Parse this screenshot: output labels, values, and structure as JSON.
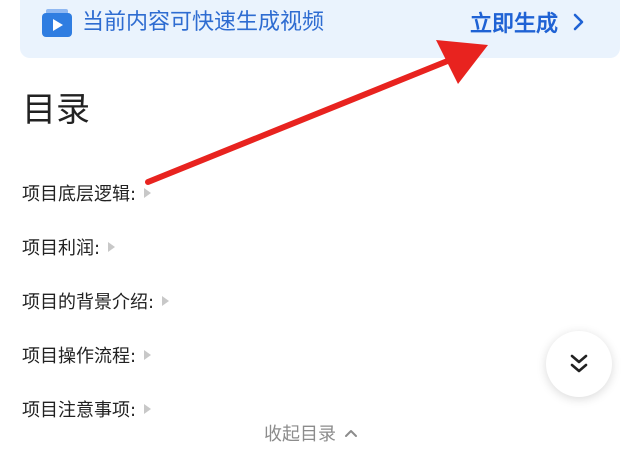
{
  "banner": {
    "text": "当前内容可快速生成视频",
    "cta_label": "立即生成",
    "icon": "video-play-icon"
  },
  "toc": {
    "title": "目录",
    "items": [
      {
        "label": "项目底层逻辑:"
      },
      {
        "label": "项目利润:"
      },
      {
        "label": "项目的背景介绍:"
      },
      {
        "label": "项目操作流程:"
      },
      {
        "label": "项目注意事项:"
      }
    ],
    "collapse_label": "收起目录"
  },
  "fab": {
    "icon": "double-chevron-down-icon"
  },
  "colors": {
    "banner_bg": "#eaf3fd",
    "banner_text": "#2e6cd1",
    "cta": "#1f62d4",
    "annotation_arrow": "#e8231f"
  }
}
